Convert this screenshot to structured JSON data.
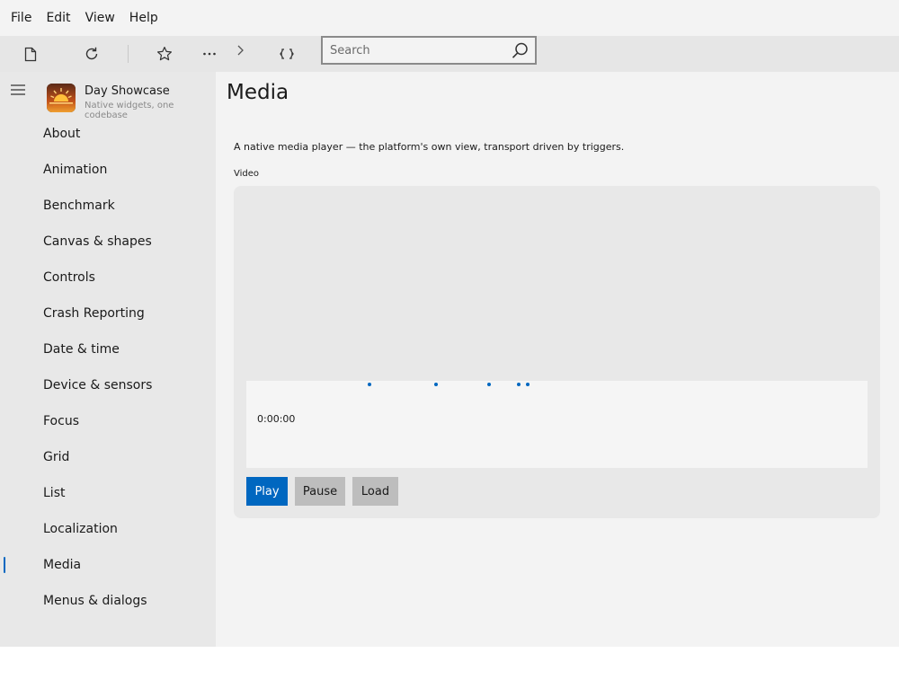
{
  "menubar": {
    "items": [
      "File",
      "Edit",
      "View",
      "Help"
    ]
  },
  "toolbar": {
    "icons": [
      "new-file-icon",
      "refresh-icon",
      "star-icon",
      "more-icon",
      "chevron-right-icon",
      "fullscreen-icon"
    ],
    "search": {
      "placeholder": "Search",
      "value": ""
    }
  },
  "sidebar": {
    "app_title": "Day Showcase",
    "app_subtitle": "Native widgets, one codebase",
    "items": [
      {
        "label": "About"
      },
      {
        "label": "Animation"
      },
      {
        "label": "Benchmark"
      },
      {
        "label": "Canvas & shapes"
      },
      {
        "label": "Controls"
      },
      {
        "label": "Crash Reporting"
      },
      {
        "label": "Date & time"
      },
      {
        "label": "Device & sensors"
      },
      {
        "label": "Focus"
      },
      {
        "label": "Grid"
      },
      {
        "label": "List"
      },
      {
        "label": "Localization"
      },
      {
        "label": "Media"
      },
      {
        "label": "Menus & dialogs"
      }
    ],
    "selected": "Media"
  },
  "main": {
    "title": "Media",
    "description": "A native media player — the platform's own view, transport driven by triggers.",
    "video_label": "Video",
    "time": "0:00:00",
    "buttons": {
      "play": "Play",
      "pause": "Pause",
      "load": "Load"
    }
  },
  "colors": {
    "accent": "#0067c0",
    "secondary_button": "#bdbdbd"
  }
}
